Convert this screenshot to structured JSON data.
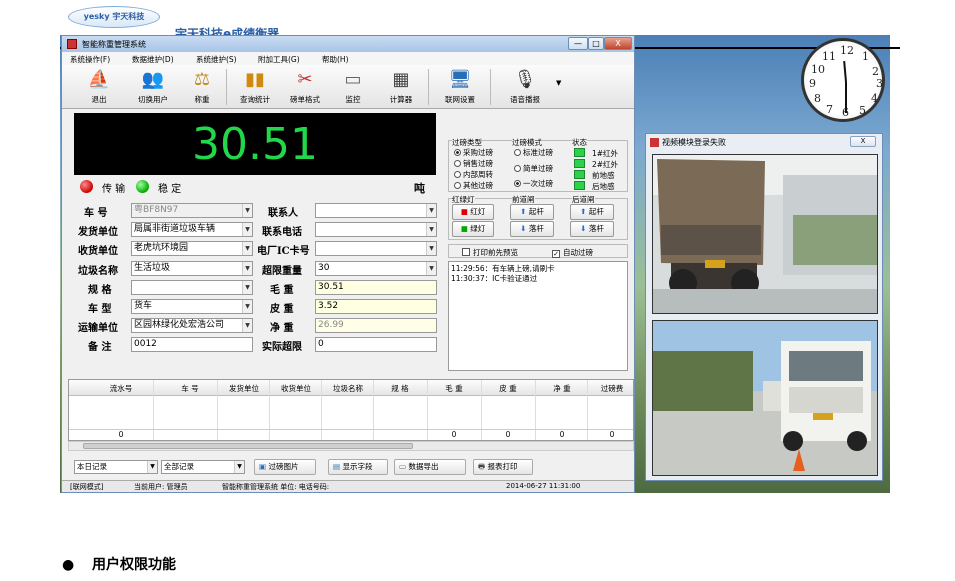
{
  "document": {
    "logo_text": "yesky 宇天科技",
    "title_partial": "宇天科技e成绩衡器",
    "section_heading": "用户权限功能"
  },
  "window": {
    "title": "智能称重管理系统",
    "controls": [
      "—",
      "□",
      "X"
    ]
  },
  "menu": [
    "系统操作(F)",
    "数据维护(D)",
    "系统维护(S)",
    "附加工具(G)",
    "帮助(H)"
  ],
  "toolbar": [
    {
      "label": "退出",
      "icon": "exit-icon"
    },
    {
      "label": "切换用户",
      "icon": "users-icon"
    },
    {
      "label": "称重",
      "icon": "scale-icon"
    },
    {
      "label": "查询统计",
      "icon": "chart-icon"
    },
    {
      "label": "磅单格式",
      "icon": "tools-icon"
    },
    {
      "label": "监控",
      "icon": "camera-icon"
    },
    {
      "label": "计算器",
      "icon": "calculator-icon"
    },
    {
      "label": "联网设置",
      "icon": "network-icon"
    },
    {
      "label": "语音播报",
      "icon": "microphone-icon"
    }
  ],
  "weight_display": {
    "value": "30.51",
    "unit": "吨",
    "color": "#22d84a"
  },
  "status": {
    "transmit": "传 输",
    "stable": "稳 定"
  },
  "form": {
    "plate_label": "车  号",
    "plate_value": "粤BF8N97",
    "sender_label": "发货单位",
    "sender_value": "局属非街道垃圾车辆",
    "receiver_label": "收货单位",
    "receiver_value": "老虎坑环境园",
    "garbage_label": "垃圾名称",
    "garbage_value": "生活垃圾",
    "spec_label": "规  格",
    "spec_value": "",
    "vehicle_type_label": "车  型",
    "vehicle_type_value": "货车",
    "transport_label": "运输单位",
    "transport_value": "区园林绿化处宏浩公司",
    "remark_label": "备  注",
    "remark_value": "0012",
    "contact_label": "联系人",
    "contact_value": "",
    "phone_label": "联系电话",
    "phone_value": "",
    "ic_label": "电厂IC卡号",
    "ic_value": "",
    "overweight_label": "超限重量",
    "overweight_value": "30",
    "gross_label": "毛  重",
    "gross_value": "30.51",
    "tare_label": "皮  重",
    "tare_value": "3.52",
    "net_label": "净  重",
    "net_value": "26.99",
    "actual_over_label": "实际超限",
    "actual_over_value": "0"
  },
  "weigh_type": {
    "title": "过磅类型",
    "options": [
      "采购过磅",
      "销售过磅",
      "内部周转",
      "其他过磅"
    ],
    "selected": 0
  },
  "weigh_mode": {
    "title": "过磅模式",
    "options": [
      "标准过磅",
      "简单过磅",
      "一次过磅"
    ],
    "selected": 2
  },
  "sensor_status": {
    "title": "状态",
    "items": [
      "1#红外",
      "2#红外",
      "前地感",
      "后地感"
    ]
  },
  "traffic_light": {
    "title": "红绿灯",
    "red": "红灯",
    "green": "绿灯"
  },
  "front_gate": {
    "title": "前道闸",
    "up": "起杆",
    "down": "落杆"
  },
  "rear_gate": {
    "title": "后道闸",
    "up": "起杆",
    "down": "落杆"
  },
  "options": {
    "print_preview": "打印前先预览",
    "auto_weigh": "自动过磅"
  },
  "log": [
    "11:29:56：有车辆上磅,请刷卡",
    "11:30:37：IC卡验证通过"
  ],
  "table": {
    "headers": [
      "流水号",
      "车 号",
      "发货单位",
      "收货单位",
      "垃圾名称",
      "规 格",
      "毛 重",
      "皮 重",
      "净 重",
      "过磅费"
    ],
    "totals": [
      "0",
      "",
      "",
      "",
      "",
      "",
      "0",
      "0",
      "0",
      "0"
    ]
  },
  "bottom": {
    "period_select": "本日记录",
    "records_select": "全部记录",
    "btn_images": "过磅图片",
    "btn_fields": "显示字段",
    "btn_export": "数据导出",
    "btn_print": "报表打印"
  },
  "statusbar": {
    "mode": "[联网模式]",
    "user": "当前用户: 管理员",
    "system": "智能称重管理系统 单位: 电话号码:",
    "datetime": "2014-06-27 11:31:00"
  },
  "video_window": {
    "title": "视频模块登录失败",
    "close": "X"
  }
}
